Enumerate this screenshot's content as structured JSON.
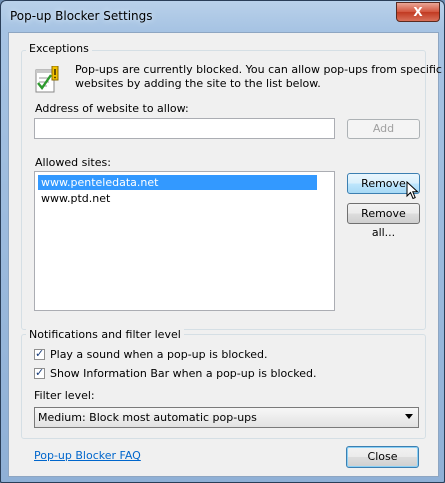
{
  "window": {
    "title": "Pop-up Blocker Settings",
    "close_glyph": "X"
  },
  "exceptions": {
    "group_label": "Exceptions",
    "info_text_line1": "Pop-ups are currently blocked.  You can allow pop-ups from specific",
    "info_text_line2": "websites by adding the site to the list below.",
    "info_icon": "checklist-warning-icon",
    "address_label": "Address of website to allow:",
    "address_value": "",
    "add_button": "Add",
    "allowed_label": "Allowed sites:",
    "allowed_sites": [
      "www.penteledata.net",
      "www.ptd.net"
    ],
    "selected_index": 0,
    "remove_button": "Remove",
    "remove_all_button": "Remove all..."
  },
  "notifications": {
    "group_label": "Notifications and filter level",
    "play_sound_label": "Play a sound when a pop-up is blocked.",
    "play_sound_checked": true,
    "info_bar_label": "Show Information Bar when a pop-up is blocked.",
    "info_bar_checked": true,
    "filter_label": "Filter level:",
    "filter_value": "Medium: Block most automatic pop-ups"
  },
  "footer": {
    "faq_link": "Pop-up Blocker FAQ",
    "close_button": "Close"
  },
  "colors": {
    "selection": "#3399ff",
    "link": "#0066cc",
    "close_red": "#c13a22"
  }
}
